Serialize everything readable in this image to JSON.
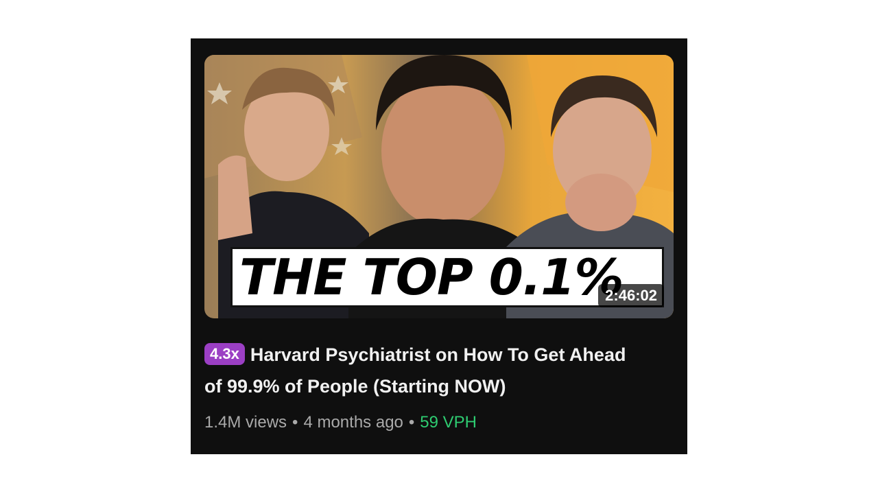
{
  "video": {
    "thumbnail_text": "THE TOP 0.1%",
    "duration": "2:46:02",
    "badge": "4.3x",
    "title": "Harvard Psychiatrist on How To Get Ahead of 99.9% of People (Starting NOW)",
    "views": "1.4M views",
    "separator": "•",
    "age": "4 months ago",
    "vph": "59 VPH"
  },
  "colors": {
    "card_background": "#0f0f0f",
    "badge": "#9b3fc4",
    "vph": "#2ecc71",
    "meta_text": "#aaaaaa"
  }
}
